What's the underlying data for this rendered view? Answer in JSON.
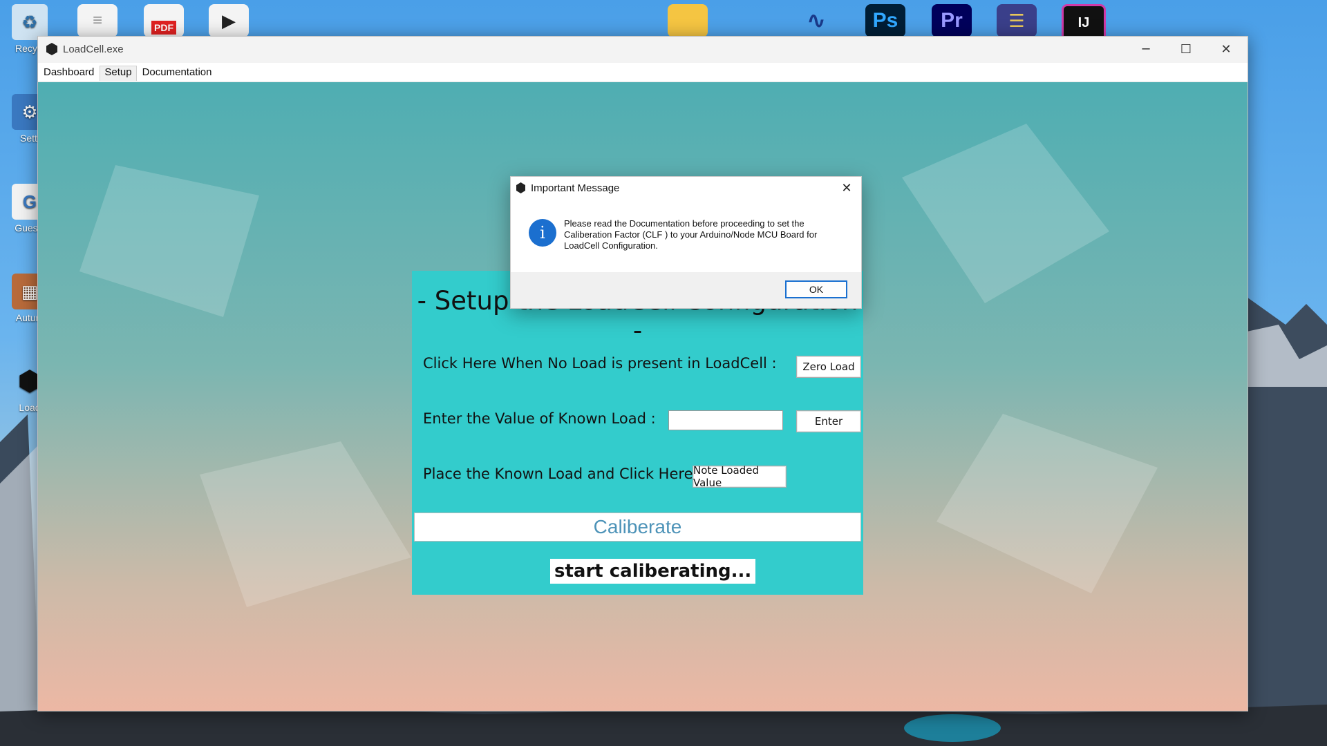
{
  "desktop": {
    "icons": [
      {
        "label": "Recycl",
        "icon": "recycle-bin-icon"
      },
      {
        "label": "Setti",
        "icon": "settings-icon"
      },
      {
        "label": "Guessi",
        "icon": "app-shortcut-icon"
      },
      {
        "label": "Autum",
        "icon": "image-file-icon"
      },
      {
        "label": "Load",
        "icon": "loadcell-app-icon"
      }
    ],
    "top_icons": [
      {
        "icon": "text-file-icon"
      },
      {
        "icon": "pdf-file-icon",
        "text": "PDF"
      },
      {
        "icon": "media-player-icon"
      },
      {
        "icon": "folder-icon"
      },
      {
        "icon": "audio-app-icon"
      },
      {
        "icon": "photoshop-icon",
        "text": "Ps"
      },
      {
        "icon": "premiere-icon",
        "text": "Pr"
      },
      {
        "icon": "mixer-app-icon"
      },
      {
        "icon": "intellij-icon",
        "text": "IJ"
      }
    ]
  },
  "window": {
    "title": "LoadCell.exe",
    "controls": {
      "minimize": "─",
      "maximize": "☐",
      "close": "✕"
    },
    "tabs": [
      "Dashboard",
      "Setup",
      "Documentation"
    ],
    "active_tab": "Setup"
  },
  "setup": {
    "title": "- Setup the LoadCell Configuration -",
    "zero_label": "Click Here When No Load is present in LoadCell :",
    "zero_button": "Zero Load",
    "known_label": "Enter the Value of Known Load :",
    "known_input_value": "",
    "enter_button": "Enter",
    "place_label": "Place the Known Load and Click Here",
    "note_button": "Note Loaded Value",
    "calibrate_button": "Caliberate",
    "status": "start caliberating..."
  },
  "dialog": {
    "title": "Important Message",
    "close": "✕",
    "info_glyph": "i",
    "message": "Please read the Documentation before proceeding to set the Caliberation Factor (CLF ) to your Arduino/Node MCU Board for LoadCell Configuration.",
    "ok_button": "OK"
  },
  "colors": {
    "panel": "#33cccc",
    "info_icon": "#1b6fcf",
    "ok_border": "#1a70d0",
    "calibrate_text": "#4d93b8"
  }
}
